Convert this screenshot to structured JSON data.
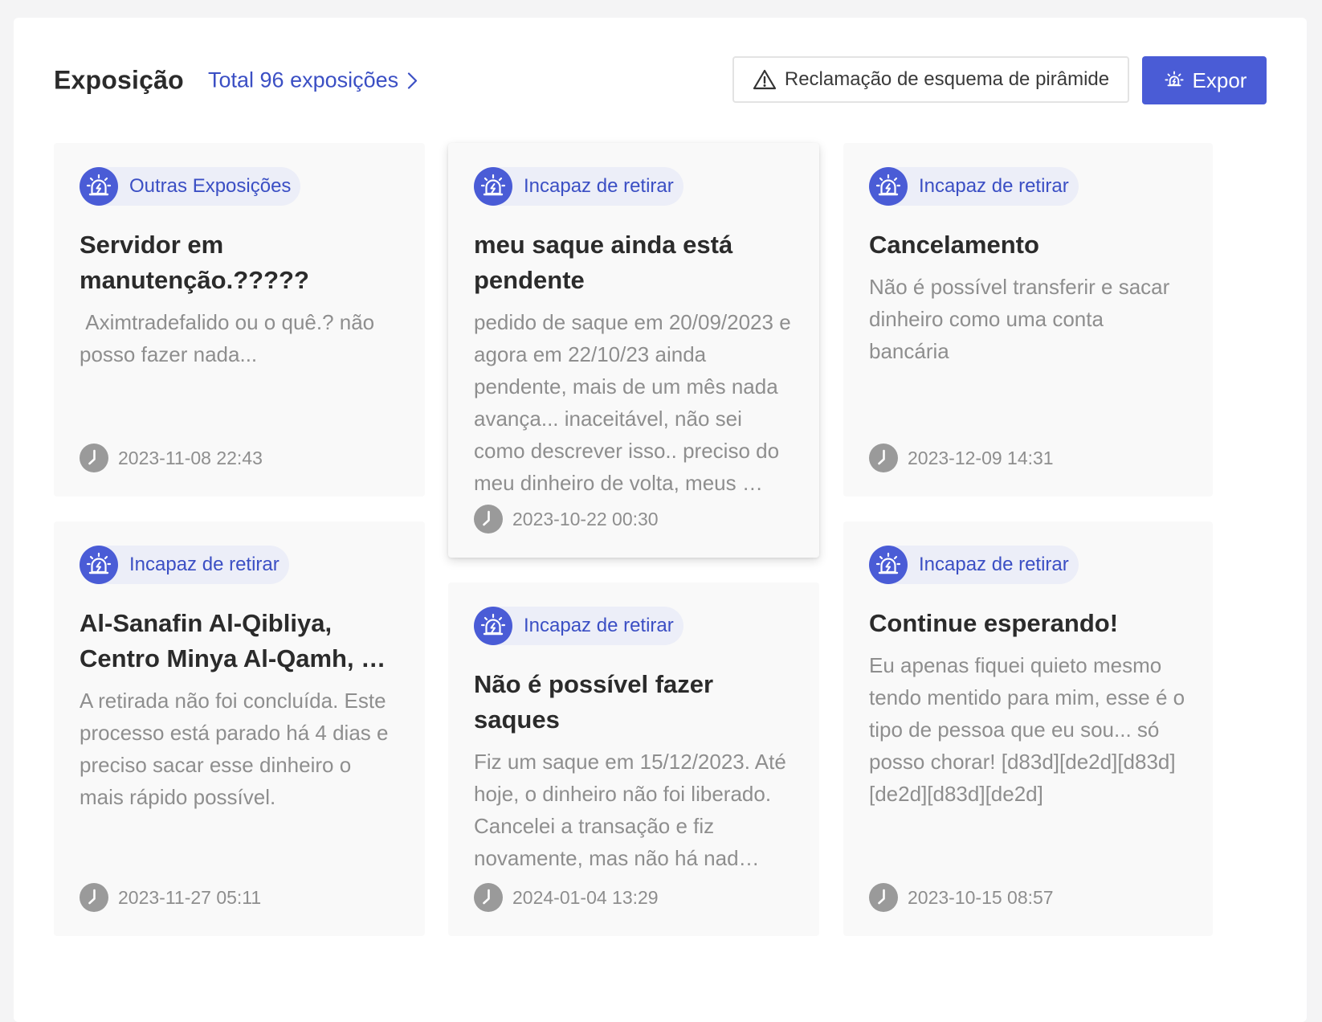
{
  "header": {
    "title": "Exposição",
    "total_link": "Total 96 exposições",
    "complaint_button": "Reclamação de esquema de pirâmide",
    "expose_button": "Expor"
  },
  "colors": {
    "accent": "#4a5cd6",
    "link": "#3b4fc4",
    "tag_bg": "#eceef8",
    "card_bg": "#f9f9f9",
    "muted_text": "#8e8e8e"
  },
  "cards": [
    {
      "tag": "Outras Exposições",
      "title": "Servidor em manutenção.?????",
      "description": " Aximtradefalido ou o quê.? não posso fazer nada...",
      "time": "2023-11-08 22:43",
      "icon": "alarm-icon"
    },
    {
      "tag": "Incapaz de retirar",
      "title": "meu saque ainda está pendente",
      "description": "pedido de saque em 20/09/2023 e agora em 22/10/23 ainda pendente, mais de um mês nada avança... inaceitável, não sei como descrever isso.. preciso do meu dinheiro de volta, meus …",
      "time": "2023-10-22 00:30",
      "icon": "alarm-icon"
    },
    {
      "tag": "Incapaz de retirar",
      "title": "Cancelamento",
      "description": "Não é possível transferir e sacar dinheiro como uma conta bancária",
      "time": "2023-12-09 14:31",
      "icon": "alarm-icon"
    },
    {
      "tag": "Incapaz de retirar",
      "title": "Al-Sanafin Al-Qibliya, Centro Minya Al-Qamh, …",
      "description": "A retirada não foi concluída. Este processo está parado há 4 dias e preciso sacar esse dinheiro o mais rápido possível.",
      "time": "2023-11-27 05:11",
      "icon": "alarm-icon"
    },
    {
      "tag": "Incapaz de retirar",
      "title": "Não é possível fazer saques",
      "description": "Fiz um saque em 15/12/2023. Até hoje, o dinheiro não foi liberado. Cancelei a transação e fiz novamente, mas não há nad…",
      "time": "2024-01-04 13:29",
      "icon": "alarm-icon"
    },
    {
      "tag": "Incapaz de retirar",
      "title": "Continue esperando!",
      "description": "Eu apenas fiquei quieto mesmo tendo mentido para mim, esse é o tipo de pessoa que eu sou... só posso chorar! [d83d][de2d][d83d][de2d][d83d][de2d]",
      "time": "2023-10-15 08:57",
      "icon": "alarm-icon"
    }
  ]
}
